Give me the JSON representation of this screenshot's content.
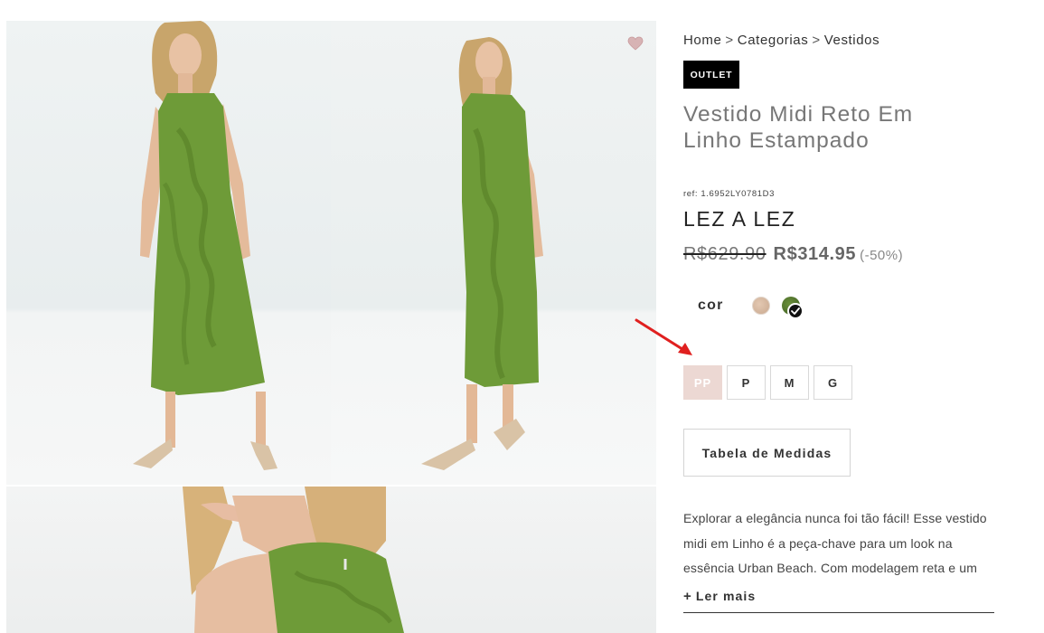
{
  "breadcrumb": [
    "Home",
    "Categorias",
    "Vestidos"
  ],
  "breadcrumb_separator": ">",
  "product": {
    "badge": "OUTLET",
    "title": "Vestido Midi Reto Em Linho Estampado",
    "ref": "ref: 1.6952LY0781D3",
    "brand": "LEZ A LEZ",
    "old_price": "R$629.90",
    "new_price": "R$314.95",
    "discount": "(-50%)"
  },
  "color": {
    "label": "cor",
    "swatches": [
      {
        "name": "beige",
        "color": "#d9bca4",
        "selected": false
      },
      {
        "name": "green",
        "color": "#557a2e",
        "selected": true
      }
    ]
  },
  "sizes": [
    {
      "label": "PP",
      "available": false
    },
    {
      "label": "P",
      "available": true
    },
    {
      "label": "M",
      "available": true
    },
    {
      "label": "G",
      "available": true
    }
  ],
  "size_table_label": "Tabela de Medidas",
  "description": "Explorar a elegância nunca foi tão fácil! Esse vestido midi em Linho é a peça-chave para um look na essência Urban Beach. Com modelagem reta e um",
  "read_more": {
    "icon": "+",
    "label": "Ler mais"
  },
  "icons": {
    "wishlist": "heart-icon",
    "check": "check-icon",
    "annotation": "red-arrow"
  },
  "colors": {
    "accent_arrow": "#e0201f",
    "badge_bg": "#000000",
    "disabled_size": "#ecd8d3",
    "dress": "#6d9a35"
  }
}
